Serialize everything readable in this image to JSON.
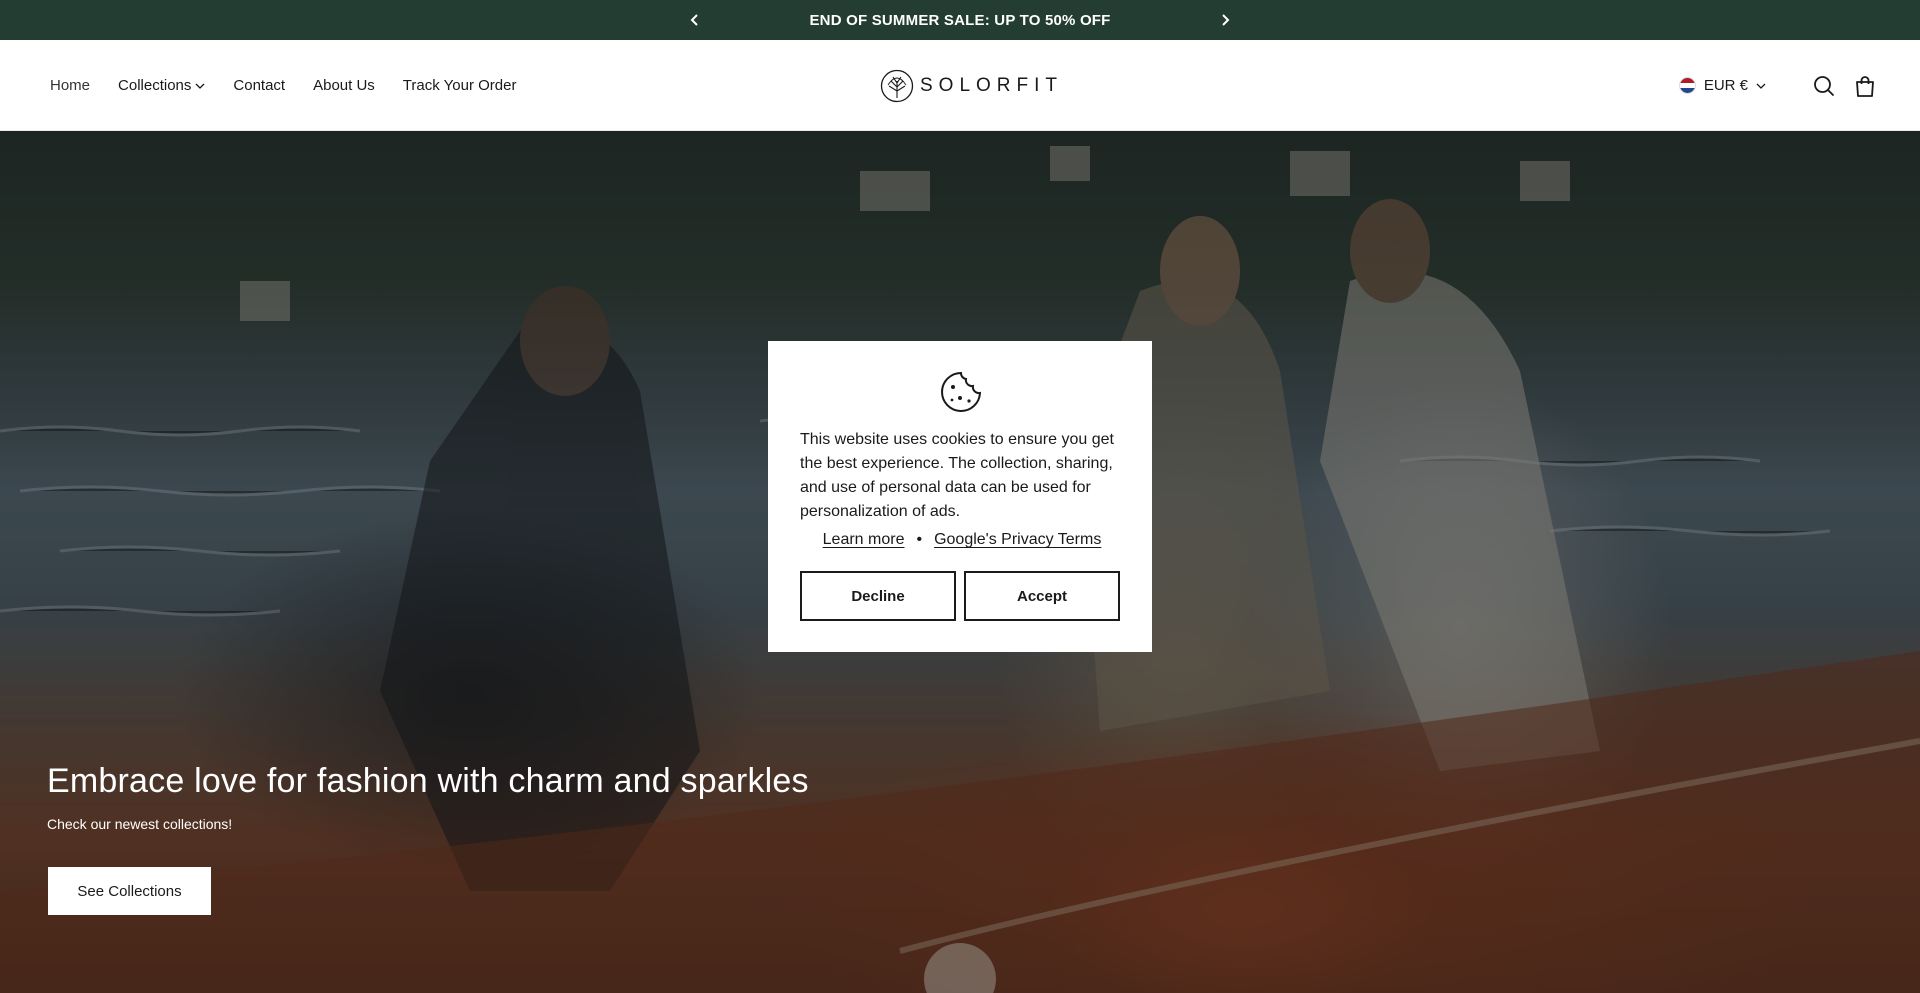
{
  "announcement": {
    "text": "END OF SUMMER SALE: UP TO 50% OFF",
    "prev_icon": "chevron-left-icon",
    "next_icon": "chevron-right-icon"
  },
  "header": {
    "nav": [
      {
        "label": "Home"
      },
      {
        "label": "Collections",
        "has_dropdown": true
      },
      {
        "label": "Contact"
      },
      {
        "label": "About Us"
      },
      {
        "label": "Track Your Order"
      }
    ],
    "logo_text": "SOLORFIT",
    "currency": "EUR €",
    "icons": [
      "netherlands-flag-icon",
      "search-icon",
      "shopping-bag-icon"
    ]
  },
  "hero": {
    "title": "Embrace love for fashion with charm and sparkles",
    "subtitle": "Check our newest collections!",
    "cta": "See Collections"
  },
  "cookie_banner": {
    "icon": "cookie-icon",
    "message": "This website uses cookies to ensure you get the best experience. The collection, sharing, and use of personal data can be used for personalization of ads.",
    "learn_more": "Learn more",
    "separator": "•",
    "privacy_link": "Google's Privacy Terms",
    "decline": "Decline",
    "accept": "Accept"
  },
  "colors": {
    "announcement_bg": "#233d32",
    "text": "#1a1a1a",
    "white": "#ffffff"
  }
}
